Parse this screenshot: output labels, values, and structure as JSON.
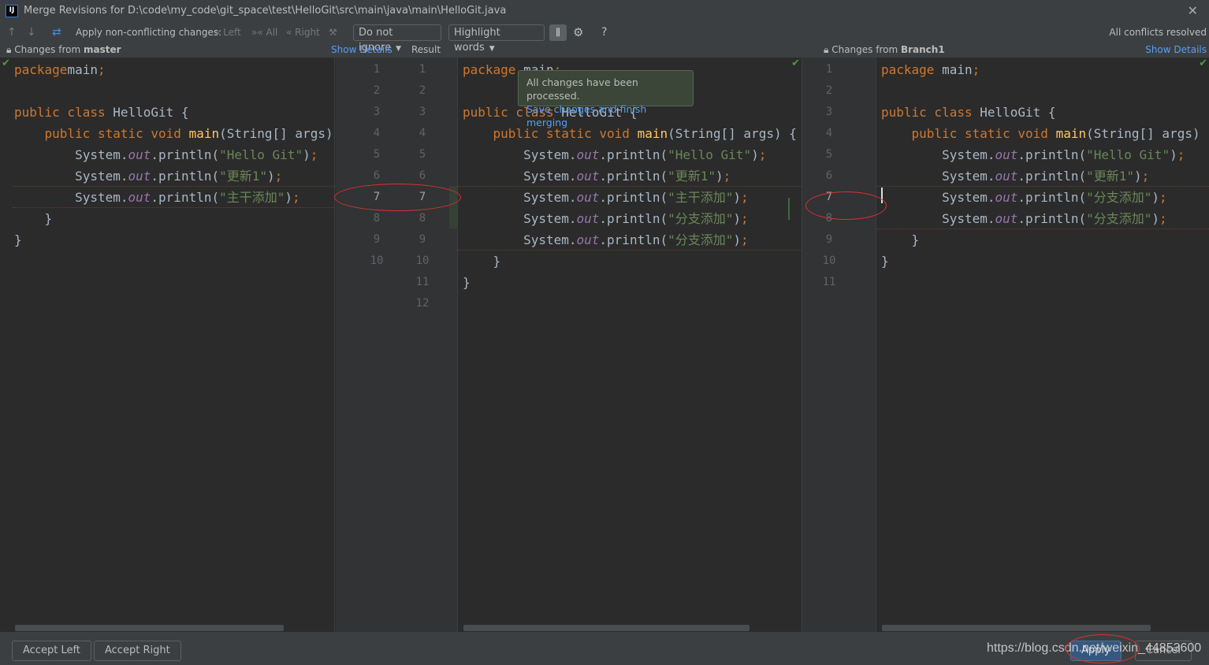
{
  "window": {
    "title": "Merge Revisions for D:\\code\\my_code\\git_space\\test\\HelloGit\\src\\main\\java\\main\\HelloGit.java",
    "app_icon": "IJ"
  },
  "toolbar": {
    "apply_label": "Apply non-conflicting changes:",
    "left": "Left",
    "all": "All",
    "right": "Right",
    "ignore_select": "Do not ignore",
    "highlight_select": "Highlight words",
    "help": "?",
    "status": "All conflicts resolved"
  },
  "headers": {
    "left_prefix": "Changes from ",
    "left_branch": "master",
    "left_details": "Show Details",
    "result": "Result",
    "right_prefix": "Changes from ",
    "right_branch": "Branch1",
    "right_details": "Show Details"
  },
  "tooltip": {
    "message": "All changes have been processed.",
    "link": "Save changes and finish merging"
  },
  "colors": {
    "keyword": "#cc7832",
    "string": "#6a8759",
    "field": "#9876aa",
    "method": "#ffc66d",
    "text": "#a9b7c6",
    "link": "#589df6",
    "annotation": "#e03030"
  },
  "left_lines": [
    [
      [
        "k",
        "package"
      ],
      [
        "",
        "main"
      ],
      [
        "k",
        ";"
      ]
    ],
    [],
    [
      [
        "k",
        "public class "
      ],
      [
        "",
        "HelloGit {"
      ]
    ],
    [
      [
        "",
        "    "
      ],
      [
        "k",
        "public static void "
      ],
      [
        "m",
        "main"
      ],
      [
        "",
        "(String[] args) {"
      ]
    ],
    [
      [
        "",
        "        System."
      ],
      [
        "o",
        "out"
      ],
      [
        "",
        ".println("
      ],
      [
        "s",
        "\"Hello Git\""
      ],
      [
        "",
        ")"
      ],
      [
        "k",
        ";"
      ]
    ],
    [
      [
        "",
        "        System."
      ],
      [
        "o",
        "out"
      ],
      [
        "",
        ".println("
      ],
      [
        "s",
        "\"更新1\""
      ],
      [
        "",
        ")"
      ],
      [
        "k",
        ";"
      ]
    ],
    [
      [
        "",
        "        System."
      ],
      [
        "o",
        "out"
      ],
      [
        "",
        ".println("
      ],
      [
        "s",
        "\"主干添加\""
      ],
      [
        "",
        ")"
      ],
      [
        "k",
        ";"
      ]
    ],
    [
      [
        "",
        "    }"
      ]
    ],
    [
      [
        "",
        "}"
      ]
    ],
    []
  ],
  "center_lines": [
    [
      [
        "k",
        "package "
      ],
      [
        "",
        "main"
      ],
      [
        "k",
        ";"
      ]
    ],
    [],
    [
      [
        "k",
        "public class "
      ],
      [
        "",
        "HelloGit {"
      ]
    ],
    [
      [
        "",
        "    "
      ],
      [
        "k",
        "public static void "
      ],
      [
        "m",
        "main"
      ],
      [
        "",
        "(String[] args) {"
      ]
    ],
    [
      [
        "",
        "        System."
      ],
      [
        "o",
        "out"
      ],
      [
        "",
        ".println("
      ],
      [
        "s",
        "\"Hello Git\""
      ],
      [
        "",
        ")"
      ],
      [
        "k",
        ";"
      ]
    ],
    [
      [
        "",
        "        System."
      ],
      [
        "o",
        "out"
      ],
      [
        "",
        ".println("
      ],
      [
        "s",
        "\"更新1\""
      ],
      [
        "",
        ")"
      ],
      [
        "k",
        ";"
      ]
    ],
    [
      [
        "",
        "        System."
      ],
      [
        "o",
        "out"
      ],
      [
        "",
        ".println("
      ],
      [
        "s",
        "\"主干添加\""
      ],
      [
        "",
        ")"
      ],
      [
        "k",
        ";"
      ]
    ],
    [
      [
        "",
        "        System."
      ],
      [
        "o",
        "out"
      ],
      [
        "",
        ".println("
      ],
      [
        "s",
        "\"分支添加\""
      ],
      [
        "",
        ")"
      ],
      [
        "k",
        ";"
      ]
    ],
    [
      [
        "",
        "        System."
      ],
      [
        "o",
        "out"
      ],
      [
        "",
        ".println("
      ],
      [
        "s",
        "\"分支添加\""
      ],
      [
        "",
        ")"
      ],
      [
        "k",
        ";"
      ]
    ],
    [
      [
        "",
        "    }"
      ]
    ],
    [
      [
        "",
        "}"
      ]
    ],
    []
  ],
  "right_lines": [
    [
      [
        "k",
        "package "
      ],
      [
        "",
        "main"
      ],
      [
        "k",
        ";"
      ]
    ],
    [],
    [
      [
        "k",
        "public class "
      ],
      [
        "",
        "HelloGit {"
      ]
    ],
    [
      [
        "",
        "    "
      ],
      [
        "k",
        "public static void "
      ],
      [
        "m",
        "main"
      ],
      [
        "",
        "(String[] args) {"
      ]
    ],
    [
      [
        "",
        "        System."
      ],
      [
        "o",
        "out"
      ],
      [
        "",
        ".println("
      ],
      [
        "s",
        "\"Hello Git\""
      ],
      [
        "",
        ")"
      ],
      [
        "k",
        ";"
      ]
    ],
    [
      [
        "",
        "        System."
      ],
      [
        "o",
        "out"
      ],
      [
        "",
        ".println("
      ],
      [
        "s",
        "\"更新1\""
      ],
      [
        "",
        ")"
      ],
      [
        "k",
        ";"
      ]
    ],
    [
      [
        "",
        "        System."
      ],
      [
        "o",
        "out"
      ],
      [
        "",
        ".println("
      ],
      [
        "s",
        "\"分支添加\""
      ],
      [
        "",
        ")"
      ],
      [
        "k",
        ";"
      ]
    ],
    [
      [
        "",
        "        System."
      ],
      [
        "o",
        "out"
      ],
      [
        "",
        ".println("
      ],
      [
        "s",
        "\"分支添加\""
      ],
      [
        "",
        ")"
      ],
      [
        "k",
        ";"
      ]
    ],
    [
      [
        "",
        "    }"
      ]
    ],
    [
      [
        "",
        "}"
      ]
    ],
    []
  ],
  "gutter": {
    "left_count": 10,
    "result_count": 12,
    "right_count": 11
  },
  "bottom": {
    "accept_left": "Accept Left",
    "accept_right": "Accept Right",
    "apply": "Apply",
    "cancel": "Cancel",
    "watermark": "https://blog.csdn.net/weixin_44853600"
  }
}
